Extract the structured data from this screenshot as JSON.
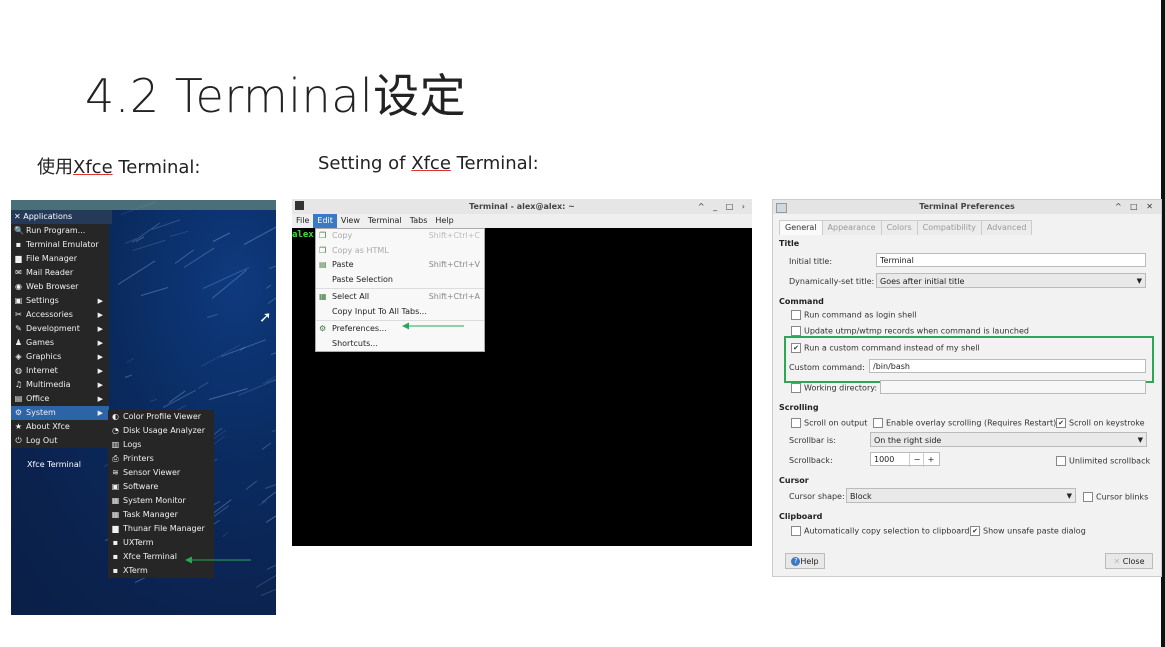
{
  "slide": {
    "title": "4.2 Terminal设定",
    "caption_left_prefix": "使用",
    "caption_left_link": "Xfce",
    "caption_left_suffix": " Terminal:",
    "caption_mid_prefix": "Setting of ",
    "caption_mid_link": "Xfce",
    "caption_mid_suffix": " Terminal:"
  },
  "panel1": {
    "apps_button": "Applications",
    "menu_items": [
      {
        "label": "Run Program...",
        "icon": "search-icon"
      },
      {
        "label": "Terminal Emulator",
        "icon": "terminal-icon"
      },
      {
        "label": "File Manager",
        "icon": "folder-icon"
      },
      {
        "label": "Mail Reader",
        "icon": "mail-icon"
      },
      {
        "label": "Web Browser",
        "icon": "globe-icon"
      },
      {
        "label": "Settings",
        "icon": "settings-icon",
        "sub": true
      },
      {
        "label": "Accessories",
        "icon": "accessories-icon",
        "sub": true
      },
      {
        "label": "Development",
        "icon": "development-icon",
        "sub": true
      },
      {
        "label": "Games",
        "icon": "games-icon",
        "sub": true
      },
      {
        "label": "Graphics",
        "icon": "graphics-icon",
        "sub": true
      },
      {
        "label": "Internet",
        "icon": "internet-icon",
        "sub": true
      },
      {
        "label": "Multimedia",
        "icon": "multimedia-icon",
        "sub": true
      },
      {
        "label": "Office",
        "icon": "office-icon",
        "sub": true
      },
      {
        "label": "System",
        "icon": "system-icon",
        "sub": true,
        "selected": true
      },
      {
        "label": "About Xfce",
        "icon": "star-icon"
      },
      {
        "label": "Log Out",
        "icon": "logout-icon"
      }
    ],
    "system_submenu": [
      {
        "label": "Color Profile Viewer",
        "icon": "color-icon"
      },
      {
        "label": "Disk Usage Analyzer",
        "icon": "disk-icon"
      },
      {
        "label": "Logs",
        "icon": "logs-icon"
      },
      {
        "label": "Printers",
        "icon": "printer-icon"
      },
      {
        "label": "Sensor Viewer",
        "icon": "sensor-icon"
      },
      {
        "label": "Software",
        "icon": "software-icon"
      },
      {
        "label": "System Monitor",
        "icon": "monitor-icon"
      },
      {
        "label": "Task Manager",
        "icon": "task-icon"
      },
      {
        "label": "Thunar File Manager",
        "icon": "folder-icon"
      },
      {
        "label": "UXTerm",
        "icon": "terminal-icon"
      },
      {
        "label": "Xfce Terminal",
        "icon": "terminal-icon"
      },
      {
        "label": "XTerm",
        "icon": "terminal-icon"
      }
    ],
    "tooltip": "Xfce Terminal"
  },
  "panel2": {
    "window_title": "Terminal - alex@alex: ~",
    "menubar": [
      "File",
      "Edit",
      "View",
      "Terminal",
      "Tabs",
      "Help"
    ],
    "active_menu": "Edit",
    "prompt": "alex",
    "edit_menu": [
      {
        "label": "Copy",
        "shortcut": "Shift+Ctrl+C",
        "disabled": true,
        "icon": "copy-icon"
      },
      {
        "label": "Copy as HTML",
        "shortcut": "",
        "disabled": true,
        "icon": "copy-icon"
      },
      {
        "label": "Paste",
        "shortcut": "Shift+Ctrl+V",
        "disabled": false,
        "icon": "paste-icon"
      },
      {
        "label": "Paste Selection",
        "shortcut": "",
        "disabled": false,
        "icon": ""
      },
      {
        "label": "Select All",
        "shortcut": "Shift+Ctrl+A",
        "disabled": false,
        "icon": "select-all-icon",
        "sep_before": true
      },
      {
        "label": "Copy Input To All Tabs...",
        "shortcut": "",
        "disabled": false,
        "icon": ""
      },
      {
        "label": "Preferences...",
        "shortcut": "",
        "disabled": false,
        "icon": "preferences-icon",
        "sep_before": true
      },
      {
        "label": "Shortcuts...",
        "shortcut": "",
        "disabled": false,
        "icon": ""
      }
    ]
  },
  "panel3": {
    "window_title": "Terminal Preferences",
    "tabs": [
      "General",
      "Appearance",
      "Colors",
      "Compatibility",
      "Advanced"
    ],
    "active_tab": "General",
    "sections": {
      "title": "Title",
      "command": "Command",
      "scrolling": "Scrolling",
      "cursor": "Cursor",
      "clipboard": "Clipboard"
    },
    "initial_title_label": "Initial title:",
    "initial_title_value": "Terminal",
    "dynamic_title_label": "Dynamically-set title:",
    "dynamic_title_value": "Goes after initial title",
    "run_login_shell": "Run command as login shell",
    "update_utmp": "Update utmp/wtmp records when command is launched",
    "run_custom": "Run a custom command instead of my shell",
    "custom_command_label": "Custom command:",
    "custom_command_value": "/bin/bash",
    "working_dir_label": "Working directory:",
    "working_dir_value": "",
    "scroll_on_output": "Scroll on output",
    "overlay_scrolling": "Enable overlay scrolling (Requires Restart)",
    "scroll_on_keystroke": "Scroll on keystroke",
    "scrollbar_label": "Scrollbar is:",
    "scrollbar_value": "On the right side",
    "scrollback_label": "Scrollback:",
    "scrollback_value": "1000",
    "minus": "−",
    "plus": "+",
    "unlimited_scrollback": "Unlimited scrollback",
    "cursor_shape_label": "Cursor shape:",
    "cursor_shape_value": "Block",
    "cursor_blinks": "Cursor blinks",
    "auto_copy": "Automatically copy selection to clipboard",
    "show_unsafe_paste": "Show unsafe paste dialog",
    "help_button": "Help",
    "close_button": "Close"
  },
  "colors": {
    "highlight_green": "#2aa855",
    "menu_selected_blue": "#2d64a8",
    "prompt_green": "#3fe03f"
  }
}
